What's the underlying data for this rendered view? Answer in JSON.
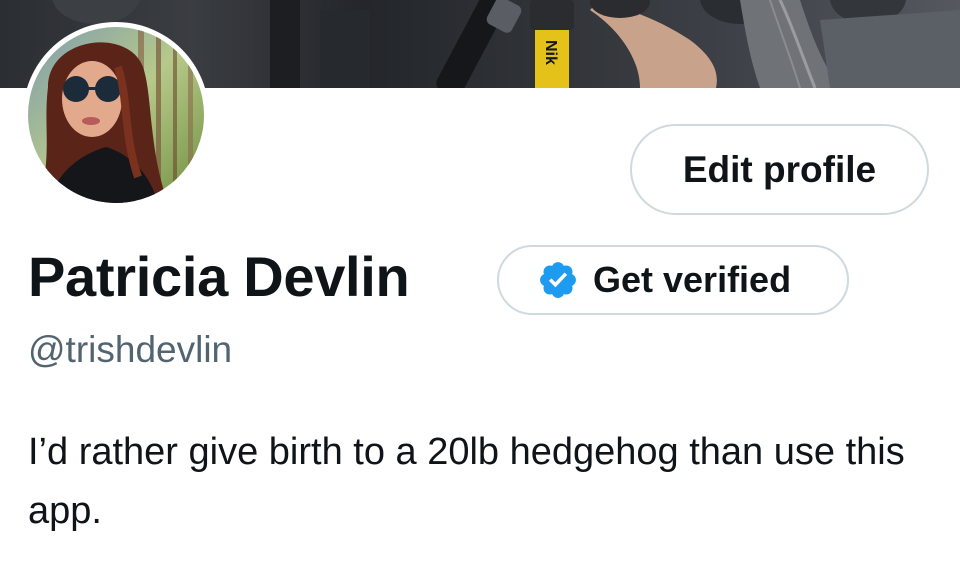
{
  "profile": {
    "display_name": "Patricia Devlin",
    "handle": "@trishdevlin",
    "bio": "I’d rather give birth to a 20lb hedgehog than use this app."
  },
  "buttons": {
    "edit_profile": "Edit profile",
    "get_verified": "Get verified"
  },
  "banner": {
    "strap_text": "Nik"
  },
  "colors": {
    "text_primary": "#0f1419",
    "text_secondary": "#536471",
    "border": "#cfd9de",
    "verified_blue": "#1d9bf0",
    "strap_yellow": "#e5c21a"
  },
  "icons": {
    "verified": "verified-badge-icon"
  }
}
